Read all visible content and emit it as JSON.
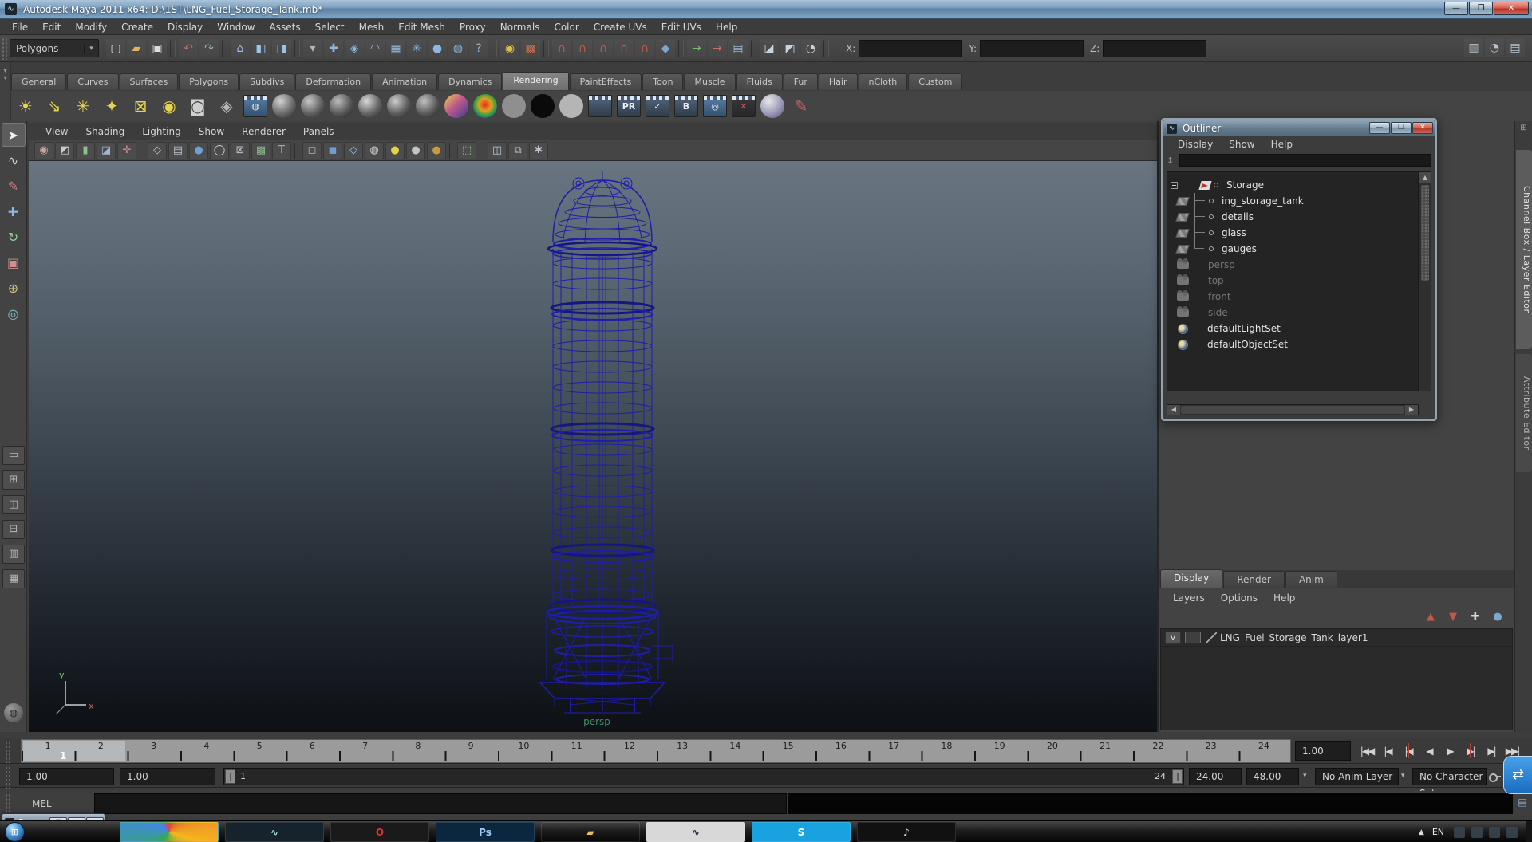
{
  "window": {
    "title": "Autodesk Maya 2011 x64: D:\\1ST\\LNG_Fuel_Storage_Tank.mb*",
    "minimize_glyph": "—",
    "maximize_glyph": "❐",
    "close_glyph": "✕",
    "app_glyph": "∿"
  },
  "menubar": {
    "items": [
      "File",
      "Edit",
      "Modify",
      "Create",
      "Display",
      "Window",
      "Assets",
      "Select",
      "Mesh",
      "Edit Mesh",
      "Proxy",
      "Normals",
      "Color",
      "Create UVs",
      "Edit UVs",
      "Help"
    ]
  },
  "status_line": {
    "menu_set": "Polygons",
    "dropdown_glyph": "▾",
    "icons": [
      {
        "name": "new-scene-icon",
        "glyph": "▢",
        "color": "#dcdcdc"
      },
      {
        "name": "open-scene-icon",
        "glyph": "▰",
        "color": "#d9b65c"
      },
      {
        "name": "save-scene-icon",
        "glyph": "▣",
        "color": "#dcdcdc"
      },
      {
        "sep": true,
        "name": "divider"
      },
      {
        "name": "undo-icon",
        "glyph": "↶",
        "color": "#c46a5a"
      },
      {
        "name": "redo-icon",
        "glyph": "↷",
        "color": "#8cc08c"
      },
      {
        "sep": true,
        "name": "divider"
      },
      {
        "name": "select-hierarchy-icon",
        "glyph": "⌂",
        "color": "#9ec1e8"
      },
      {
        "name": "select-object-icon",
        "glyph": "◧",
        "color": "#9ec1e8"
      },
      {
        "name": "select-component-icon",
        "glyph": "◨",
        "color": "#9ec1e8"
      },
      {
        "sep": true,
        "name": "divider"
      },
      {
        "name": "selection-mask-dropdown",
        "glyph": "▾",
        "color": "#b5b5b5"
      },
      {
        "name": "select-by-handles-icon",
        "glyph": "✚",
        "color": "#8fb8e0"
      },
      {
        "name": "select-by-joints-icon",
        "glyph": "◈",
        "color": "#8fb8e0"
      },
      {
        "name": "select-by-curves-icon",
        "glyph": "◠",
        "color": "#8fb8e0"
      },
      {
        "name": "select-by-surfaces-icon",
        "glyph": "▦",
        "color": "#8fb8e0"
      },
      {
        "name": "select-by-deformations-icon",
        "glyph": "✳",
        "color": "#8fb8e0"
      },
      {
        "name": "select-by-dynamics-icon",
        "glyph": "●",
        "color": "#8fb8e0"
      },
      {
        "name": "select-by-rendering-icon",
        "glyph": "◍",
        "color": "#8fb8e0"
      },
      {
        "name": "select-misc-icon",
        "glyph": "?",
        "color": "#8fb8e0"
      },
      {
        "sep": true,
        "name": "divider"
      },
      {
        "name": "lock-selection-icon",
        "glyph": "◉",
        "color": "#e0c040"
      },
      {
        "name": "highlight-selection-icon",
        "glyph": "▩",
        "color": "#d07050"
      },
      {
        "sep": true,
        "name": "divider"
      },
      {
        "name": "snap-to-grids-icon",
        "glyph": "∩",
        "color": "#c05848"
      },
      {
        "name": "snap-to-curves-icon",
        "glyph": "∩",
        "color": "#c05848"
      },
      {
        "name": "snap-to-points-icon",
        "glyph": "∩",
        "color": "#c05848"
      },
      {
        "name": "snap-to-projected-center-icon",
        "glyph": "∩",
        "color": "#c05848"
      },
      {
        "name": "snap-to-view-planes-icon",
        "glyph": "∩",
        "color": "#c05848"
      },
      {
        "name": "make-live-icon",
        "glyph": "◆",
        "color": "#7fa8d0"
      },
      {
        "sep": true,
        "name": "divider"
      },
      {
        "name": "input-connections-icon",
        "glyph": "→",
        "color": "#6fbf6f"
      },
      {
        "name": "output-connections-icon",
        "glyph": "→",
        "color": "#cf6f5f"
      },
      {
        "name": "construction-history-icon",
        "glyph": "▤",
        "color": "#9ab4cc"
      },
      {
        "sep": true,
        "name": "divider"
      },
      {
        "name": "render-current-frame-icon",
        "glyph": "◪",
        "color": "#c9d4de"
      },
      {
        "name": "ipr-render-icon",
        "glyph": "◩",
        "color": "#c9d4de"
      },
      {
        "name": "render-settings-icon",
        "glyph": "◔",
        "color": "#c9d4de"
      },
      {
        "sep": true,
        "name": "divider"
      }
    ],
    "coords": {
      "x_label": "X:",
      "y_label": "Y:",
      "z_label": "Z:",
      "x_value": "",
      "y_value": "",
      "z_value": ""
    },
    "right_icons": [
      {
        "name": "toggle-attribute-editor-icon",
        "glyph": "▥",
        "color": "#b8c4ce"
      },
      {
        "name": "toggle-tool-settings-icon",
        "glyph": "◔",
        "color": "#b8c4ce"
      },
      {
        "name": "toggle-channel-box-icon",
        "glyph": "▤",
        "color": "#b8c4ce"
      }
    ]
  },
  "shelf": {
    "collapse_glyphs": [
      "▾",
      "▾"
    ],
    "tabs": [
      {
        "label": "General"
      },
      {
        "label": "Curves"
      },
      {
        "label": "Surfaces"
      },
      {
        "label": "Polygons"
      },
      {
        "label": "Subdivs"
      },
      {
        "label": "Deformation"
      },
      {
        "label": "Animation"
      },
      {
        "label": "Dynamics"
      },
      {
        "label": "Rendering",
        "cls": "active"
      },
      {
        "label": "PaintEffects"
      },
      {
        "label": "Toon"
      },
      {
        "label": "Muscle"
      },
      {
        "label": "Fluids"
      },
      {
        "label": "Fur"
      },
      {
        "label": "Hair"
      },
      {
        "label": "nCloth"
      },
      {
        "label": "Custom"
      }
    ],
    "icons": [
      {
        "name": "ambient-light-icon",
        "glyph": "☀",
        "color": "#e6d44a"
      },
      {
        "name": "directional-light-icon",
        "glyph": "⇘",
        "color": "#e6d44a"
      },
      {
        "name": "point-light-icon",
        "glyph": "✳",
        "color": "#e6d44a"
      },
      {
        "name": "spot-light-icon",
        "glyph": "✦",
        "color": "#e6d44a"
      },
      {
        "name": "area-light-icon",
        "glyph": "⊠",
        "color": "#e6d44a"
      },
      {
        "name": "volume-light-icon",
        "glyph": "◉",
        "color": "#e6d44a"
      },
      {
        "name": "camera-icon",
        "glyph": "◙",
        "color": "#cfcfcf"
      },
      {
        "name": "camera-aim-icon",
        "glyph": "◈",
        "color": "#b8b8b8"
      },
      {
        "name": "hypershade-icon",
        "cls": "slate",
        "glyph": "◍",
        "bg": "linear-gradient(180deg,#5b80a8,#33506e)"
      },
      {
        "name": "anisotropic-material-icon",
        "cls": "sphere",
        "bg": "radial-gradient(circle at 35% 30%,#d2d2d2,#6a6a6a 55%,#242424)"
      },
      {
        "name": "blinn-material-icon",
        "cls": "sphere",
        "bg": "radial-gradient(circle at 35% 30%,#c8c8c8,#606060 55%,#202020)"
      },
      {
        "name": "lambert-material-icon",
        "cls": "sphere",
        "bg": "radial-gradient(circle at 35% 30%,#bcbcbc,#585858 55%,#1e1e1e)"
      },
      {
        "name": "phong-material-icon",
        "cls": "sphere",
        "bg": "radial-gradient(circle at 35% 30%,#d8d8d8,#646464 55%,#222)"
      },
      {
        "name": "phong-e-material-icon",
        "cls": "sphere",
        "bg": "radial-gradient(circle at 35% 30%,#cccccc,#5c5c5c 55%,#1f1f1f)"
      },
      {
        "name": "layered-shader-icon",
        "cls": "sphere",
        "bg": "radial-gradient(circle at 35% 30%,#c2c2c2,#5a5a5a 55%,#1d1d1d)"
      },
      {
        "name": "ramp-shader-icon",
        "cls": "sphere",
        "bg": "linear-gradient(135deg,#e8d24a,#c05a8a 45%,#3a3a9a)"
      },
      {
        "name": "rainbow-shader-icon",
        "cls": "sphere",
        "bg": "radial-gradient(circle at 50% 45%,#e03020,#e0a020 35%,#30a040 60%,#2040c0 85%)"
      },
      {
        "name": "flat-gray-material-icon",
        "cls": "sphere",
        "bg": "#8f8f8f"
      },
      {
        "name": "black-material-icon",
        "cls": "sphere",
        "bg": "#0a0a0a"
      },
      {
        "name": "light-gray-material-icon",
        "cls": "sphere",
        "bg": "#b5b5b5"
      },
      {
        "name": "render-current-frame-icon",
        "cls": "slate",
        "glyph": "",
        "bg": "linear-gradient(180deg,#55687e,#2e3c4c)"
      },
      {
        "name": "ipr-render-icon",
        "cls": "slate",
        "glyph": "PR",
        "bg": "linear-gradient(180deg,#55687e,#2e3c4c)"
      },
      {
        "name": "render-settings-icon",
        "cls": "slate",
        "glyph": "✓",
        "bg": "linear-gradient(180deg,#55687e,#2e3c4c)"
      },
      {
        "name": "batch-render-icon",
        "cls": "slate",
        "glyph": "B",
        "bg": "linear-gradient(180deg,#55687e,#2e3c4c)"
      },
      {
        "name": "render-view-icon",
        "cls": "slate",
        "glyph": "◎",
        "bg": "linear-gradient(180deg,#5b80a8,#33506e)"
      },
      {
        "name": "cancel-batch-render-icon",
        "cls": "slate",
        "glyph": "✕",
        "color": "#e05050",
        "bg": "linear-gradient(180deg,#3a3a3a,#262626)"
      },
      {
        "name": "show-batch-render-icon",
        "cls": "sphere",
        "bg": "radial-gradient(circle at 35% 30%,#e8e8e8,#9a9ab8 55%,#5a4a7a)"
      },
      {
        "name": "paint-effects-icon",
        "glyph": "✎",
        "color": "#d06060"
      }
    ]
  },
  "panel": {
    "menus": [
      "View",
      "Shading",
      "Lighting",
      "Show",
      "Renderer",
      "Panels"
    ],
    "toolbar_icons": [
      {
        "name": "select-camera-icon",
        "glyph": "◉",
        "color": "#c9a0a0"
      },
      {
        "name": "camera-attributes-icon",
        "glyph": "◩",
        "color": "#c9c9c9"
      },
      {
        "name": "bookmark-icon",
        "glyph": "▮",
        "color": "#8fc08f"
      },
      {
        "name": "image-plane-icon",
        "glyph": "◪",
        "color": "#9fb8cf"
      },
      {
        "name": "2d-pan-zoom-icon",
        "glyph": "✛",
        "color": "#cf8f8f"
      },
      {
        "sep": true,
        "name": "divider"
      },
      {
        "name": "wireframe-mode-icon",
        "glyph": "◇",
        "color": "#b9c4ce"
      },
      {
        "name": "film-gate-icon",
        "glyph": "▤",
        "color": "#b9c4ce"
      },
      {
        "name": "shaded-mode-icon",
        "glyph": "●",
        "color": "#6f9fd8"
      },
      {
        "name": "smooth-shade-icon",
        "glyph": "◯",
        "color": "#d8d8d8"
      },
      {
        "name": "bounding-box-icon",
        "glyph": "⊠",
        "color": "#b9c4ce"
      },
      {
        "name": "textured-mode-icon",
        "glyph": "▩",
        "color": "#8fb88f"
      },
      {
        "name": "text-hud-icon",
        "glyph": "T",
        "color": "#7fc87f"
      },
      {
        "sep": true,
        "name": "divider"
      },
      {
        "name": "default-material-cube-icon",
        "glyph": "◻",
        "color": "#b5b5b5"
      },
      {
        "name": "shaded-cube-icon",
        "glyph": "◼",
        "color": "#6f9fd8"
      },
      {
        "name": "xray-cube-icon",
        "glyph": "◇",
        "color": "#9fc4e8"
      },
      {
        "name": "checker-sphere-icon",
        "glyph": "◍",
        "color": "#d8d8d8"
      },
      {
        "name": "use-all-lights-icon",
        "glyph": "●",
        "color": "#e2d24a"
      },
      {
        "name": "default-light-icon",
        "glyph": "●",
        "color": "#c4c4c4"
      },
      {
        "name": "no-lights-icon",
        "glyph": "●",
        "color": "#c89a3f"
      },
      {
        "sep": true,
        "name": "divider"
      },
      {
        "name": "isolate-select-icon",
        "glyph": "⬚",
        "color": "#8fc88f"
      },
      {
        "sep": true,
        "name": "divider"
      },
      {
        "name": "wireframe-on-shaded-icon",
        "glyph": "◫",
        "color": "#b9c4ce"
      },
      {
        "name": "xray-mode-icon",
        "glyph": "⧉",
        "color": "#b9c4ce"
      },
      {
        "name": "plug-icon",
        "glyph": "✱",
        "color": "#b9c4ce"
      }
    ],
    "camera_label": "persp",
    "axis_y": "y",
    "axis_x": "x"
  },
  "toolbox": {
    "tools": [
      {
        "name": "select-tool",
        "glyph": "➤",
        "color": "#f0f0f0",
        "cls": "active"
      },
      {
        "name": "lasso-select-tool",
        "glyph": "∿",
        "color": "#d5d5d5"
      },
      {
        "name": "paint-select-tool",
        "glyph": "✎",
        "color": "#d08080"
      },
      {
        "name": "move-tool",
        "glyph": "✚",
        "color": "#8fb8e0"
      },
      {
        "name": "rotate-tool",
        "glyph": "↻",
        "color": "#8fd0a0"
      },
      {
        "name": "scale-tool",
        "glyph": "▣",
        "color": "#d08f8f"
      },
      {
        "name": "universal-manipulator-tool",
        "glyph": "⊕",
        "color": "#d0c080"
      },
      {
        "name": "soft-mod-tool",
        "glyph": "◎",
        "color": "#80c0d0"
      }
    ],
    "layouts": [
      {
        "name": "layout-single-pane-button",
        "glyph": "▭"
      },
      {
        "name": "layout-four-pane-button",
        "glyph": "⊞"
      },
      {
        "name": "layout-two-side-by-side-button",
        "glyph": "◫"
      },
      {
        "name": "layout-two-stacked-button",
        "glyph": "⊟"
      },
      {
        "name": "layout-three-pane-button",
        "glyph": "▥"
      },
      {
        "name": "layout-outliner-persp-button",
        "glyph": "▦"
      }
    ],
    "hotbox_glyph": "◍"
  },
  "outliner": {
    "title": "Outliner",
    "menus": [
      "Display",
      "Show",
      "Help"
    ],
    "filter_placeholder": "",
    "items": [
      {
        "label": "Storage"
      },
      {
        "label": "ing_storage_tank"
      },
      {
        "label": "details"
      },
      {
        "label": "glass"
      },
      {
        "label": "gauges"
      },
      {
        "label": "persp"
      },
      {
        "label": "top"
      },
      {
        "label": "front"
      },
      {
        "label": "side"
      },
      {
        "label": "defaultLightSet"
      },
      {
        "label": "defaultObjectSet"
      }
    ]
  },
  "layer_editor": {
    "tabs": [
      {
        "label": "Display",
        "cls": "active"
      },
      {
        "label": "Render"
      },
      {
        "label": "Anim"
      }
    ],
    "menus": [
      "Layers",
      "Options",
      "Help"
    ],
    "toolbar_icons": [
      {
        "name": "move-layer-up-button",
        "glyph": "▲",
        "color": "#c05848"
      },
      {
        "name": "move-layer-down-button",
        "glyph": "▼",
        "color": "#c05848"
      },
      {
        "name": "create-empty-layer-button",
        "glyph": "✚",
        "color": "#d8d8d8"
      },
      {
        "name": "create-layer-from-selected-button",
        "glyph": "●",
        "color": "#7fa8d0"
      }
    ],
    "layers": [
      {
        "visible": "V",
        "name": "LNG_Fuel_Storage_Tank_layer1"
      }
    ]
  },
  "right_tabs": {
    "channel_box": "Channel Box / Layer Editor",
    "attribute_editor": "Attribute Editor"
  },
  "timeline": {
    "frames": [
      1,
      2,
      3,
      4,
      5,
      6,
      7,
      8,
      9,
      10,
      11,
      12,
      13,
      14,
      15,
      16,
      17,
      18,
      19,
      20,
      21,
      22,
      23,
      24
    ],
    "current_frame": "1",
    "current_time": "1.00",
    "playback": [
      {
        "name": "go-to-start-button",
        "glyph": "|◀◀"
      },
      {
        "name": "step-back-frame-button",
        "glyph": "|◀"
      },
      {
        "name": "step-back-key-button",
        "glyph": "|◀",
        "cls": "key"
      },
      {
        "name": "play-backwards-button",
        "glyph": "◀"
      },
      {
        "name": "play-forward-button",
        "glyph": "▶"
      },
      {
        "name": "step-forward-key-button",
        "glyph": "▶|",
        "cls": "key"
      },
      {
        "name": "step-forward-frame-button",
        "glyph": "▶|"
      },
      {
        "name": "go-to-end-button",
        "glyph": "▶▶|"
      }
    ]
  },
  "range_slider": {
    "anim_start": "1.00",
    "playback_start": "1.00",
    "range_start_label": "1",
    "range_end_label": "24",
    "playback_end": "24.00",
    "anim_end": "48.00",
    "anim_layer": "No Anim Layer",
    "character_set": "No Character Set",
    "dropdown_glyph": "▾"
  },
  "command_line": {
    "label": "MEL",
    "value": ""
  },
  "taskbar": {
    "mini_window_title": "C...",
    "tray_language": "EN",
    "tray_arrow": "▲",
    "start_glyph": "⊞",
    "icons": [
      {
        "name": "taskbar-chrome-icon",
        "cls": "circle",
        "bg": "conic-gradient(#e04434,#f5b81e 30%,#34a853 60%,#4285f4 85%,#e04434)",
        "glyph": "",
        "color": "#fff"
      },
      {
        "name": "taskbar-maya-icon",
        "bg": "#16222c",
        "glyph": "∿",
        "color": "#9fd8c8"
      },
      {
        "name": "taskbar-opera-icon",
        "cls": "circle",
        "bg": "#1a1a1a",
        "glyph": "O",
        "color": "#e03030"
      },
      {
        "name": "taskbar-photoshop-icon",
        "bg": "#0b2740",
        "glyph": "Ps",
        "color": "#9fc8f0"
      },
      {
        "name": "taskbar-folder-icon",
        "bg": "transparent",
        "glyph": "▰",
        "color": "#e8c060"
      },
      {
        "name": "taskbar-maya-doc-icon",
        "bg": "#d8d8d8",
        "glyph": "∿",
        "color": "#223344"
      },
      {
        "name": "taskbar-skype-icon",
        "cls": "circle",
        "bg": "#18a3e0",
        "glyph": "S",
        "color": "#fff"
      },
      {
        "name": "taskbar-music-icon",
        "cls": "circle",
        "bg": "#111",
        "glyph": "♪",
        "color": "#ddd"
      }
    ]
  }
}
